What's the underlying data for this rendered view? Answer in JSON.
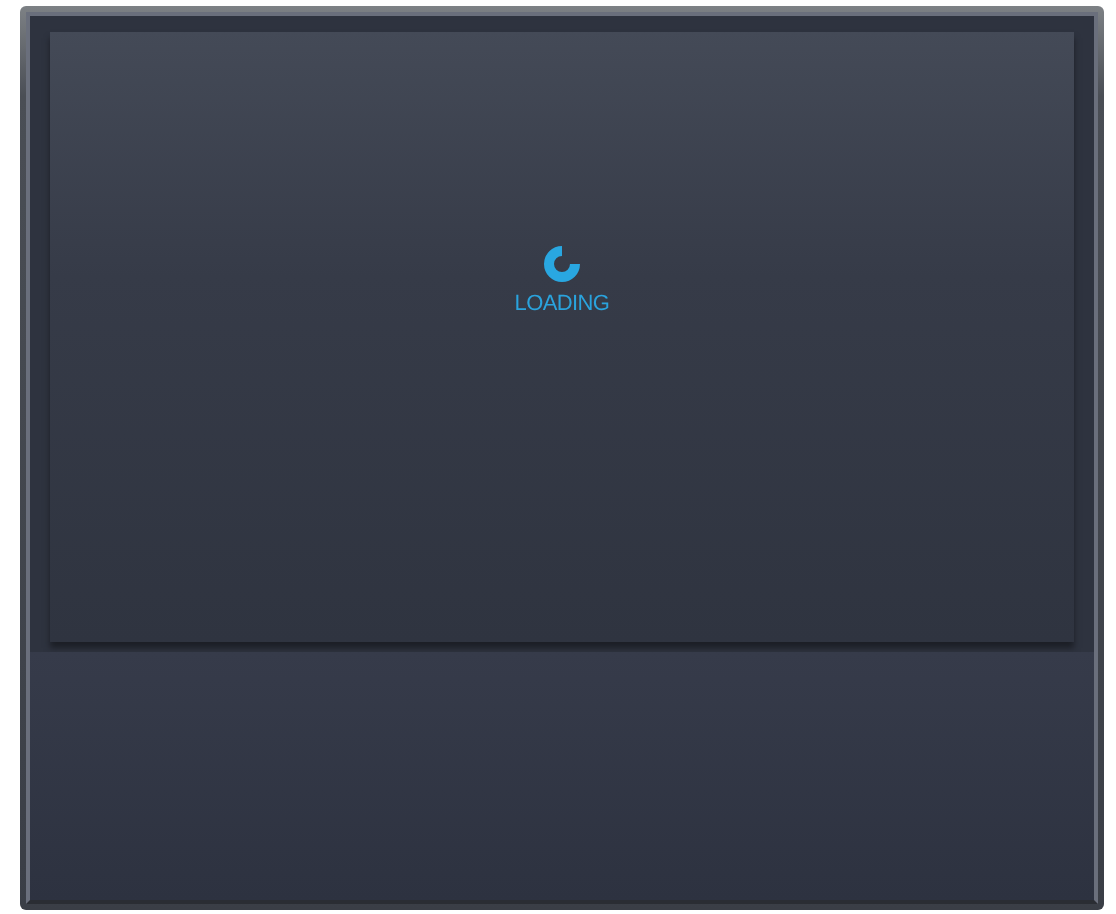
{
  "loading": {
    "label": "LOADING"
  }
}
